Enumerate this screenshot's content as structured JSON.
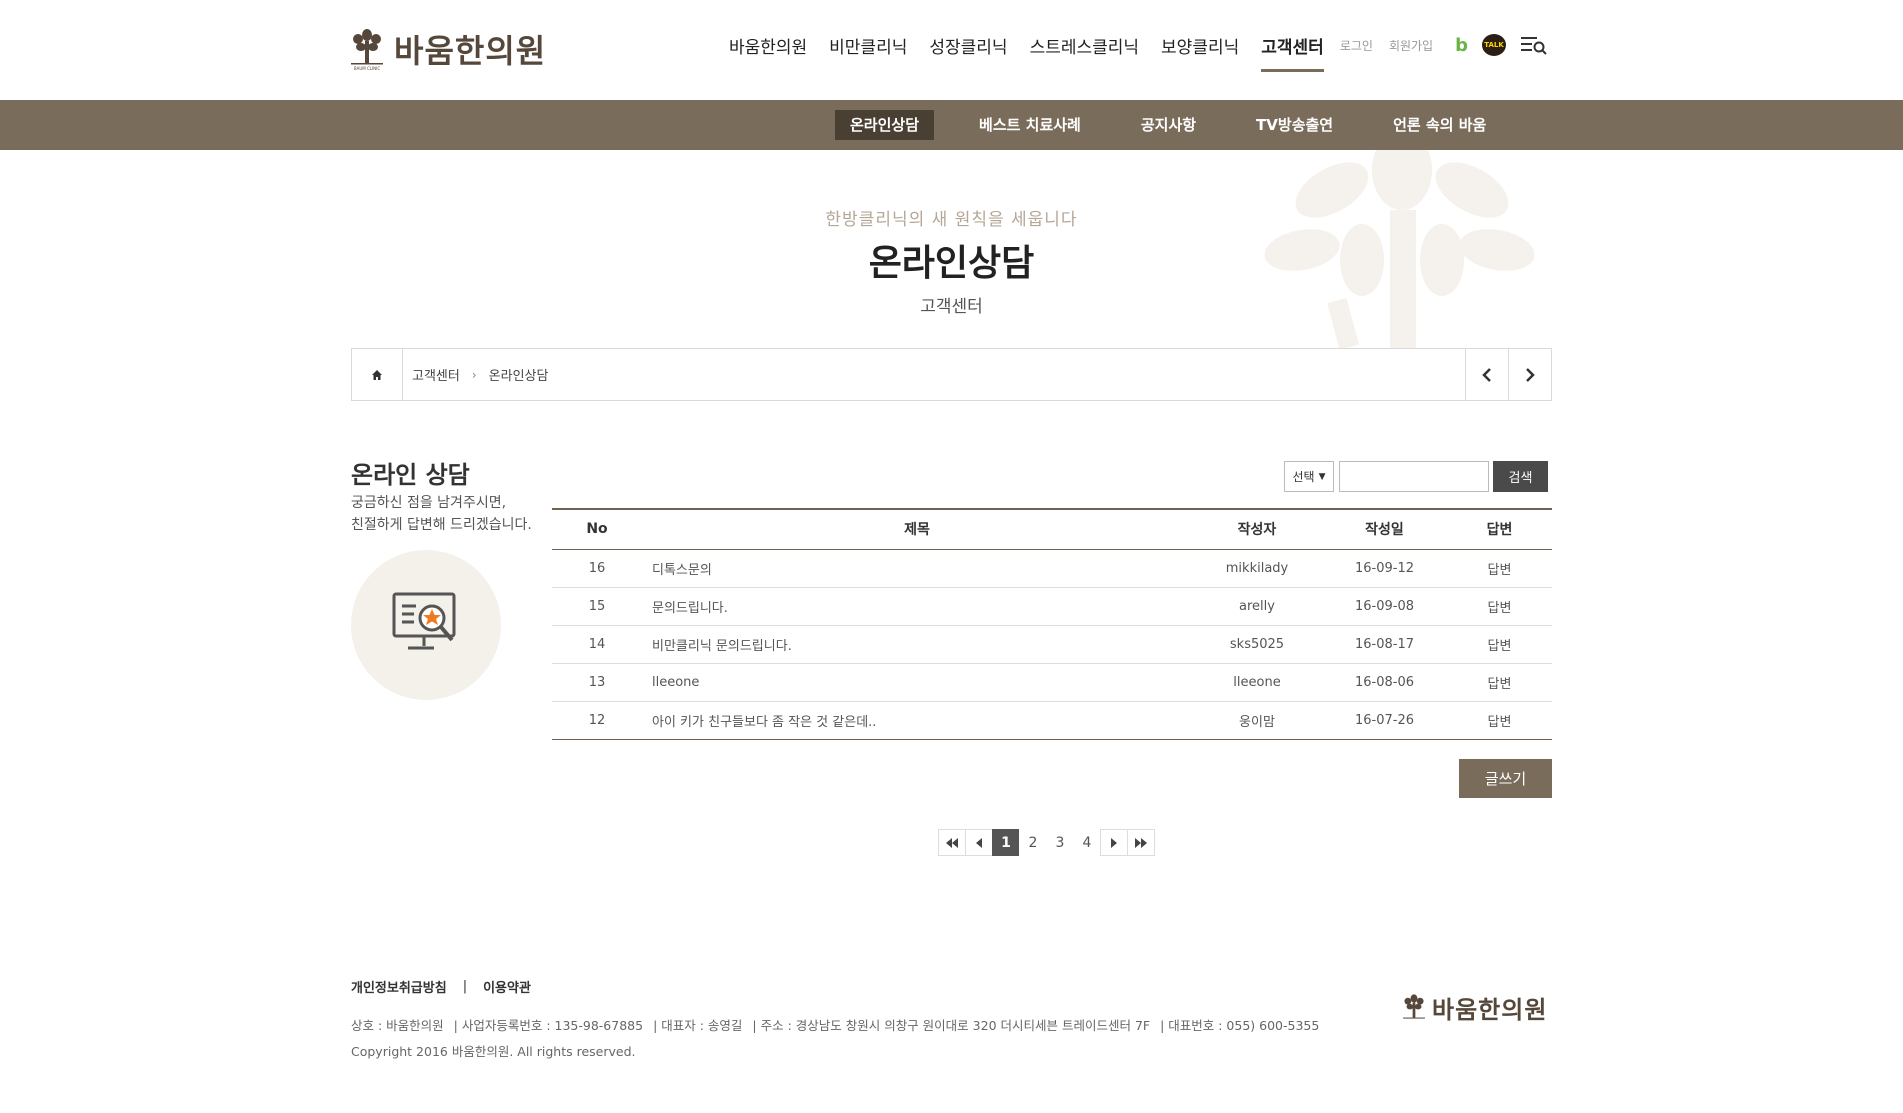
{
  "brand": {
    "name": "바움한의원",
    "sub": "BAUM CLINIC",
    "color": "#55473a"
  },
  "nav": {
    "items": [
      "바움한의원",
      "비만클리닉",
      "성장클리닉",
      "스트레스클리닉",
      "보양클리닉",
      "고객센터"
    ],
    "login": "로그인",
    "join": "회원가입",
    "blog": "b",
    "talk": "TALK"
  },
  "subnav": {
    "items": [
      "온라인상담",
      "베스트 치료사례",
      "공지사항",
      "TV방송출연",
      "언론 속의 바움"
    ]
  },
  "hero": {
    "slogan": "한방클리닉의 새 원칙을 세웁니다",
    "title": "온라인상담",
    "sub": "고객센터"
  },
  "breadcrumb": {
    "level1": "고객센터",
    "level2": "온라인상담"
  },
  "side": {
    "title": "온라인 상담",
    "desc1": "궁금하신 점을 남겨주시면,",
    "desc2": "친절하게 답변해 드리겠습니다."
  },
  "search": {
    "select": "선택",
    "placeholder": "",
    "button": "검색"
  },
  "table": {
    "headers": {
      "no": "No",
      "title": "제목",
      "author": "작성자",
      "date": "작성일",
      "reply": "답변"
    },
    "rows": [
      {
        "no": "16",
        "title": "디톡스문의",
        "author": "mikkilady",
        "date": "16-09-12",
        "reply": "답변"
      },
      {
        "no": "15",
        "title": "문의드립니다.",
        "author": "arelly",
        "date": "16-09-08",
        "reply": "답변"
      },
      {
        "no": "14",
        "title": "비만클리닉 문의드립니다.",
        "author": "sks5025",
        "date": "16-08-17",
        "reply": "답변"
      },
      {
        "no": "13",
        "title": "lleeone",
        "author": "lleeone",
        "date": "16-08-06",
        "reply": "답변"
      },
      {
        "no": "12",
        "title": "아이 키가 친구들보다 좀 작은 것 같은데..",
        "author": "웅이맘",
        "date": "16-07-26",
        "reply": "답변"
      }
    ]
  },
  "write_button": "글쓰기",
  "pager": {
    "pages": [
      "1",
      "2",
      "3",
      "4"
    ]
  },
  "footer": {
    "privacy": "개인정보취급방침",
    "bar": "|",
    "terms": "이용약관",
    "company": "상호 : 바움한의원",
    "bizno": "| 사업자등록번호 : 135-98-67885",
    "ceo": "| 대표자 : 송영길",
    "address": "| 주소 : 경상남도 창원시 의창구 원이대로 320 더시티세븐 트레이드센터 7F",
    "tel": "| 대표번호 : 055) 600-5355",
    "copyright": "Copyright 2016 바움한의원. All rights reserved."
  }
}
